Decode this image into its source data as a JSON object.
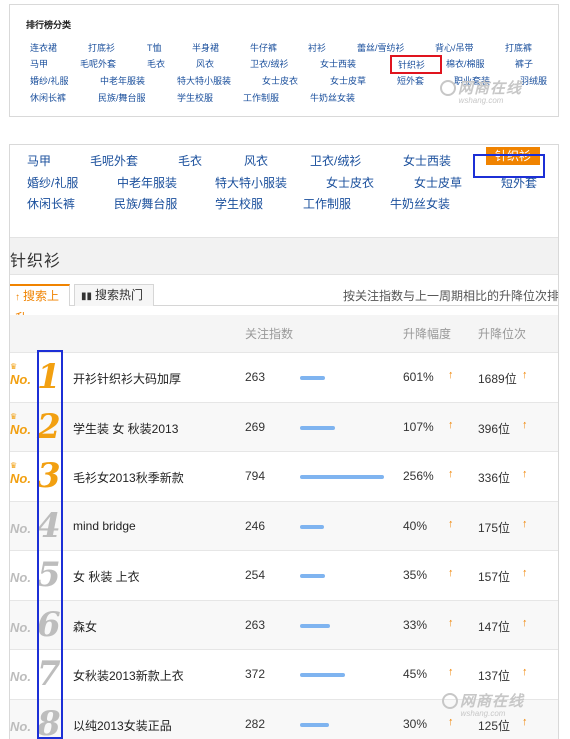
{
  "top_panel": {
    "title": "排行榜分类",
    "categories": [
      "连衣裙",
      "打底衫",
      "T恤",
      "半身裙",
      "牛仔裤",
      "衬衫",
      "蕾丝/雪纺衫",
      "背心/吊带",
      "打底裤",
      "马甲",
      "毛呢外套",
      "毛衣",
      "风衣",
      "卫衣/绒衫",
      "女士西装",
      "针织衫",
      "棉衣/棉服",
      "裤子",
      "婚纱/礼服",
      "中老年服装",
      "特大特小服装",
      "女士皮衣",
      "女士皮草",
      "短外套",
      "职业套装",
      "羽绒服",
      "休闲长裤",
      "民族/舞台服",
      "学生校服",
      "工作制服",
      "牛奶丝女装"
    ],
    "selected": "针织衫"
  },
  "watermark": {
    "brand": "网商在线",
    "url": "wshang.com"
  },
  "main_panel": {
    "categories": [
      "马甲",
      "毛呢外套",
      "毛衣",
      "风衣",
      "卫衣/绒衫",
      "女士西装",
      "婚纱/礼服",
      "中老年服装",
      "特大特小服装",
      "女士皮衣",
      "女士皮草",
      "短外套",
      "休闲长裤",
      "民族/舞台服",
      "学生校服",
      "工作制服",
      "牛奶丝女装"
    ],
    "selected_tab": "针织衫",
    "section_title": "针织衫",
    "tabs": {
      "rise": "搜索上升",
      "hot": "搜索热门"
    },
    "tab_note": "按关注指数与上一周期相比的升降位次排序",
    "columns": {
      "attention": "关注指数",
      "change": "升降幅度",
      "rank_change": "升降位次"
    },
    "rows": [
      {
        "no": "No.",
        "rank": "1",
        "keyword": "开衫针织衫大码加厚",
        "attention": "263",
        "level": 0.3,
        "pct": "601%",
        "pos": "1689位"
      },
      {
        "no": "No.",
        "rank": "2",
        "keyword": "学生装 女 秋装2013",
        "attention": "269",
        "level": 0.42,
        "pct": "107%",
        "pos": "396位"
      },
      {
        "no": "No.",
        "rank": "3",
        "keyword": "毛衫女2013秋季新款",
        "attention": "794",
        "level": 1.0,
        "pct": "256%",
        "pos": "336位"
      },
      {
        "no": "No.",
        "rank": "4",
        "keyword": "mind bridge",
        "attention": "246",
        "level": 0.28,
        "pct": "40%",
        "pos": "175位"
      },
      {
        "no": "No.",
        "rank": "5",
        "keyword": "女 秋装 上衣",
        "attention": "254",
        "level": 0.3,
        "pct": "35%",
        "pos": "157位"
      },
      {
        "no": "No.",
        "rank": "6",
        "keyword": "森女",
        "attention": "263",
        "level": 0.36,
        "pct": "33%",
        "pos": "147位"
      },
      {
        "no": "No.",
        "rank": "7",
        "keyword": "女秋装2013新款上衣",
        "attention": "372",
        "level": 0.53,
        "pct": "45%",
        "pos": "137位"
      },
      {
        "no": "No.",
        "rank": "8",
        "keyword": "以纯2013女装正品",
        "attention": "282",
        "level": 0.34,
        "pct": "30%",
        "pos": "125位"
      }
    ]
  }
}
